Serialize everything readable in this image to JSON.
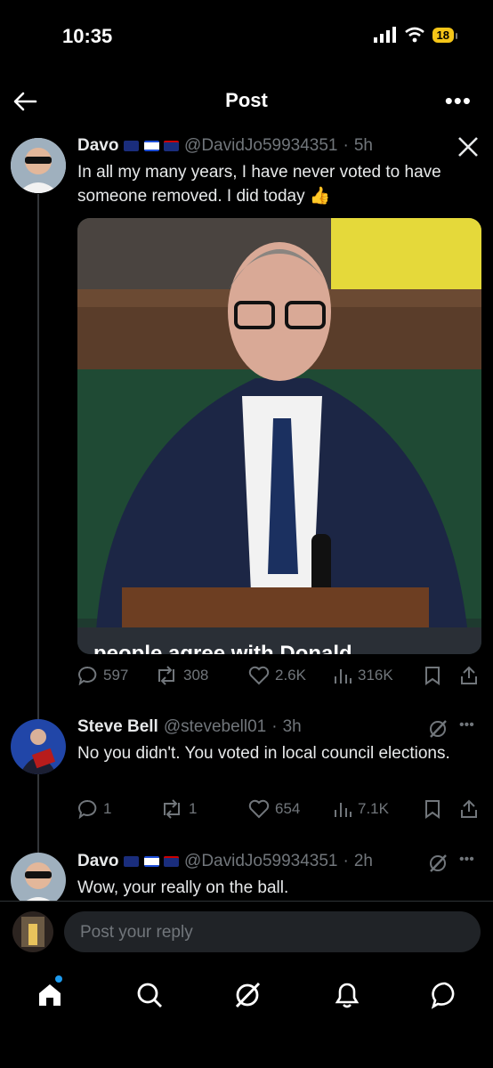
{
  "status": {
    "time": "10:35",
    "battery": "18"
  },
  "header": {
    "title": "Post"
  },
  "main_post": {
    "name": "Davo",
    "handle": "@DavidJo59934351",
    "time": "5h",
    "text": "In all my many years, I have never voted to have someone removed. I did today",
    "emoji": "👍",
    "media_caption": "people agree with Donald",
    "stats": {
      "replies": "597",
      "reposts": "308",
      "likes": "2.6K",
      "views": "316K"
    }
  },
  "replies": [
    {
      "name": "Steve Bell",
      "handle": "@stevebell01",
      "time": "3h",
      "text": "No you didn't. You voted in local council elections.",
      "stats": {
        "replies": "1",
        "reposts": "1",
        "likes": "654",
        "views": "7.1K"
      }
    },
    {
      "name": "Davo",
      "handle": "@DavidJo59934351",
      "time": "2h",
      "text": "Wow, your really on the ball."
    }
  ],
  "composer": {
    "placeholder": "Post your reply"
  },
  "colors": {
    "accent": "#1d9bf0",
    "muted": "#71767b",
    "bg": "#000000"
  }
}
